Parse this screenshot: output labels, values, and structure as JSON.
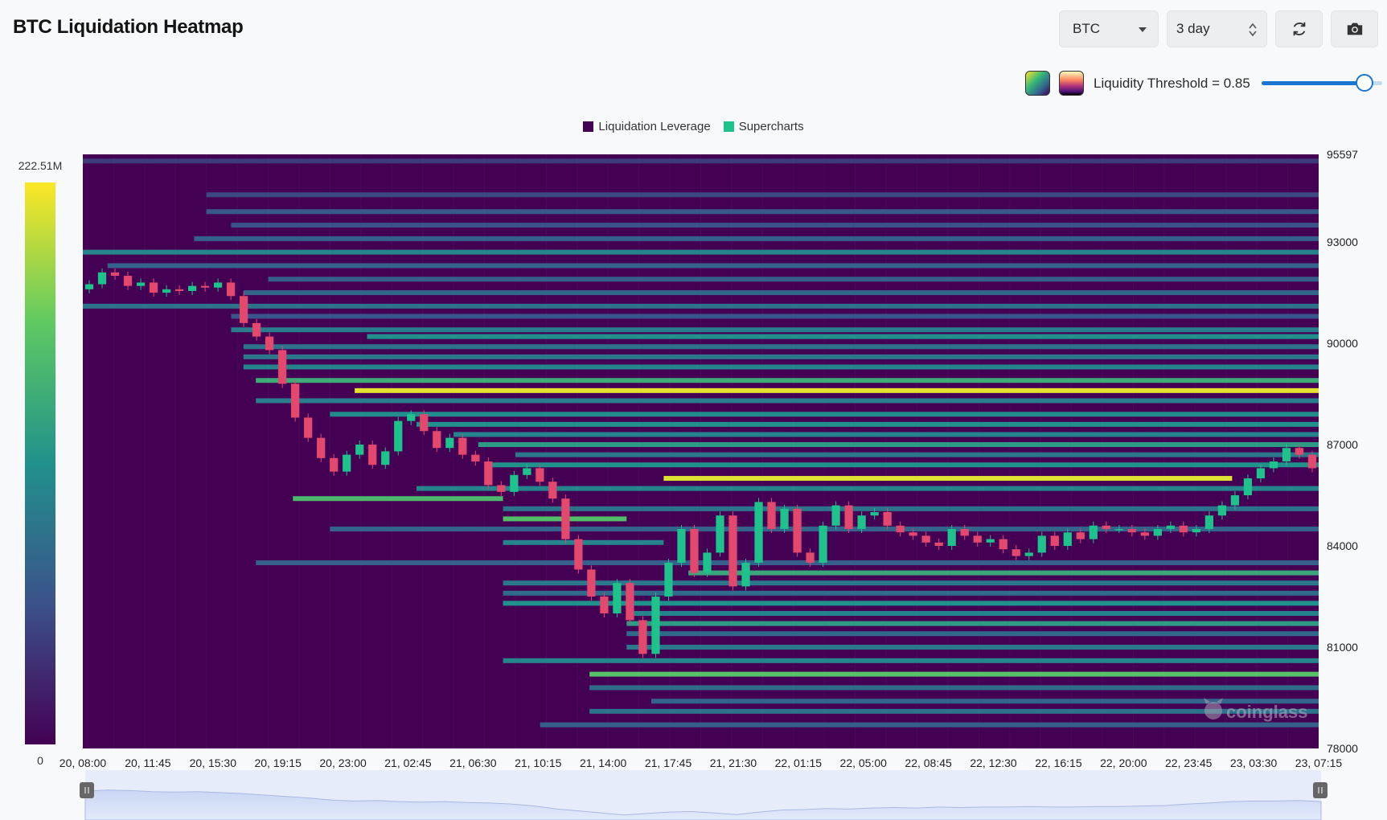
{
  "header": {
    "title": "BTC Liquidation Heatmap",
    "symbol_select": "BTC",
    "range_select": "3 day",
    "refresh_icon": "refresh-icon",
    "camera_icon": "camera-icon"
  },
  "controls": {
    "palette_swatches": [
      "viridis",
      "magma"
    ],
    "threshold_label": "Liquidity Threshold = 0.85",
    "threshold_value": 0.85
  },
  "colors": {
    "heat_low": "#440154",
    "heat_mid": "#21918c",
    "heat_high": "#fde725",
    "candle_up": "#1ec28b",
    "candle_down": "#e3486e",
    "accent": "#1976d2"
  },
  "watermark": "coinglass",
  "chart_data": {
    "type": "heatmap",
    "title": "",
    "legend": [
      {
        "name": "Liquidation Leverage",
        "color": "#440154"
      },
      {
        "name": "Supercharts",
        "color": "#1ec28b"
      }
    ],
    "legend_position": "top-center",
    "colorbar": {
      "max_label": "222.51M",
      "min_label": "0",
      "max": 222.51,
      "min": 0,
      "unit": "M"
    },
    "y_axis": {
      "min": 78000,
      "max": 95597,
      "ticks": [
        95597,
        93000,
        90000,
        87000,
        84000,
        81000,
        78000
      ],
      "position": "right"
    },
    "x_axis": {
      "ticks": [
        "20, 08:00",
        "20, 11:45",
        "20, 15:30",
        "20, 19:15",
        "20, 23:00",
        "21, 02:45",
        "21, 06:30",
        "21, 10:15",
        "21, 14:00",
        "21, 17:45",
        "21, 21:30",
        "22, 01:15",
        "22, 05:00",
        "22, 08:45",
        "22, 12:30",
        "22, 16:15",
        "22, 20:00",
        "22, 23:45",
        "23, 03:30",
        "23, 07:15"
      ]
    },
    "liquidation_bands": [
      {
        "price": 95400,
        "start": 0,
        "end": 1,
        "intensity": 0.18
      },
      {
        "price": 94400,
        "start": 0.1,
        "end": 1,
        "intensity": 0.22
      },
      {
        "price": 93900,
        "start": 0.1,
        "end": 1,
        "intensity": 0.28
      },
      {
        "price": 93500,
        "start": 0.12,
        "end": 1,
        "intensity": 0.25
      },
      {
        "price": 93100,
        "start": 0.09,
        "end": 1,
        "intensity": 0.3
      },
      {
        "price": 92700,
        "start": 0,
        "end": 1,
        "intensity": 0.45
      },
      {
        "price": 92300,
        "start": 0.02,
        "end": 1,
        "intensity": 0.32
      },
      {
        "price": 91900,
        "start": 0.15,
        "end": 1,
        "intensity": 0.3
      },
      {
        "price": 91500,
        "start": 0.13,
        "end": 1,
        "intensity": 0.33
      },
      {
        "price": 91100,
        "start": 0,
        "end": 1,
        "intensity": 0.38
      },
      {
        "price": 90800,
        "start": 0.12,
        "end": 1,
        "intensity": 0.26
      },
      {
        "price": 90400,
        "start": 0.12,
        "end": 1,
        "intensity": 0.42
      },
      {
        "price": 90200,
        "start": 0.23,
        "end": 1,
        "intensity": 0.5
      },
      {
        "price": 89900,
        "start": 0.13,
        "end": 1,
        "intensity": 0.38
      },
      {
        "price": 89600,
        "start": 0.13,
        "end": 1,
        "intensity": 0.4
      },
      {
        "price": 89300,
        "start": 0.13,
        "end": 1,
        "intensity": 0.45
      },
      {
        "price": 88900,
        "start": 0.14,
        "end": 1,
        "intensity": 0.62
      },
      {
        "price": 88600,
        "start": 0.22,
        "end": 1,
        "intensity": 0.96
      },
      {
        "price": 88300,
        "start": 0.14,
        "end": 1,
        "intensity": 0.42
      },
      {
        "price": 87900,
        "start": 0.2,
        "end": 1,
        "intensity": 0.48
      },
      {
        "price": 87600,
        "start": 0.27,
        "end": 1,
        "intensity": 0.5
      },
      {
        "price": 87300,
        "start": 0.3,
        "end": 1,
        "intensity": 0.45
      },
      {
        "price": 87000,
        "start": 0.32,
        "end": 1,
        "intensity": 0.55
      },
      {
        "price": 86700,
        "start": 0.35,
        "end": 1,
        "intensity": 0.4
      },
      {
        "price": 86400,
        "start": 0.33,
        "end": 1,
        "intensity": 0.5
      },
      {
        "price": 86000,
        "start": 0.47,
        "end": 0.93,
        "intensity": 0.95
      },
      {
        "price": 85700,
        "start": 0.27,
        "end": 1,
        "intensity": 0.45
      },
      {
        "price": 85400,
        "start": 0.17,
        "end": 0.34,
        "intensity": 0.68
      },
      {
        "price": 85100,
        "start": 0.34,
        "end": 1,
        "intensity": 0.38
      },
      {
        "price": 84800,
        "start": 0.34,
        "end": 0.44,
        "intensity": 0.7
      },
      {
        "price": 84500,
        "start": 0.2,
        "end": 1,
        "intensity": 0.32
      },
      {
        "price": 84100,
        "start": 0.34,
        "end": 0.47,
        "intensity": 0.45
      },
      {
        "price": 83500,
        "start": 0.14,
        "end": 1,
        "intensity": 0.3
      },
      {
        "price": 83200,
        "start": 0.49,
        "end": 1,
        "intensity": 0.6
      },
      {
        "price": 82900,
        "start": 0.34,
        "end": 1,
        "intensity": 0.4
      },
      {
        "price": 82600,
        "start": 0.34,
        "end": 1,
        "intensity": 0.35
      },
      {
        "price": 82300,
        "start": 0.34,
        "end": 1,
        "intensity": 0.5
      },
      {
        "price": 82000,
        "start": 0.44,
        "end": 1,
        "intensity": 0.45
      },
      {
        "price": 81700,
        "start": 0.44,
        "end": 1,
        "intensity": 0.55
      },
      {
        "price": 81400,
        "start": 0.44,
        "end": 1,
        "intensity": 0.35
      },
      {
        "price": 81000,
        "start": 0.44,
        "end": 1,
        "intensity": 0.4
      },
      {
        "price": 80600,
        "start": 0.34,
        "end": 1,
        "intensity": 0.45
      },
      {
        "price": 80200,
        "start": 0.41,
        "end": 1,
        "intensity": 0.72
      },
      {
        "price": 79800,
        "start": 0.41,
        "end": 1,
        "intensity": 0.35
      },
      {
        "price": 79400,
        "start": 0.46,
        "end": 1,
        "intensity": 0.32
      },
      {
        "price": 79100,
        "start": 0.41,
        "end": 1,
        "intensity": 0.38
      },
      {
        "price": 78700,
        "start": 0.37,
        "end": 1,
        "intensity": 0.3
      }
    ],
    "price_series_close": [
      91750,
      92100,
      92000,
      91700,
      91800,
      91500,
      91600,
      91550,
      91700,
      91650,
      91800,
      91400,
      90600,
      90200,
      89800,
      88800,
      87800,
      87200,
      86600,
      86200,
      86700,
      87000,
      86400,
      86800,
      87700,
      87900,
      87400,
      86900,
      87200,
      86700,
      86500,
      85800,
      85600,
      86100,
      86300,
      85900,
      85400,
      84200,
      83300,
      82500,
      82000,
      82900,
      81800,
      80800,
      82500,
      83500,
      84500,
      83200,
      83800,
      84900,
      82800,
      83500,
      85300,
      84500,
      85100,
      83800,
      83500,
      84600,
      85200,
      84500,
      84900,
      85000,
      84600,
      84400,
      84300,
      84100,
      84000,
      84500,
      84300,
      84100,
      84200,
      83900,
      83700,
      83800,
      84300,
      84000,
      84400,
      84200,
      84600,
      84500,
      84500,
      84400,
      84300,
      84500,
      84600,
      84400,
      84500,
      84900,
      85200,
      85500,
      86000,
      86300,
      86500,
      86900,
      86700,
      86300
    ]
  },
  "navigator_series": [
    0.42,
    0.4,
    0.41,
    0.43,
    0.44,
    0.43,
    0.45,
    0.47,
    0.5,
    0.53,
    0.56,
    0.6,
    0.62,
    0.61,
    0.63,
    0.64,
    0.63,
    0.65,
    0.66,
    0.68,
    0.72,
    0.78,
    0.82,
    0.86,
    0.9,
    0.87,
    0.84,
    0.83,
    0.86,
    0.89,
    0.84,
    0.8,
    0.79,
    0.77,
    0.78,
    0.76,
    0.75,
    0.76,
    0.74,
    0.75,
    0.74,
    0.74,
    0.73,
    0.74,
    0.74,
    0.73,
    0.73,
    0.72,
    0.71,
    0.68,
    0.66,
    0.63,
    0.62,
    0.62,
    0.61,
    0.63
  ]
}
